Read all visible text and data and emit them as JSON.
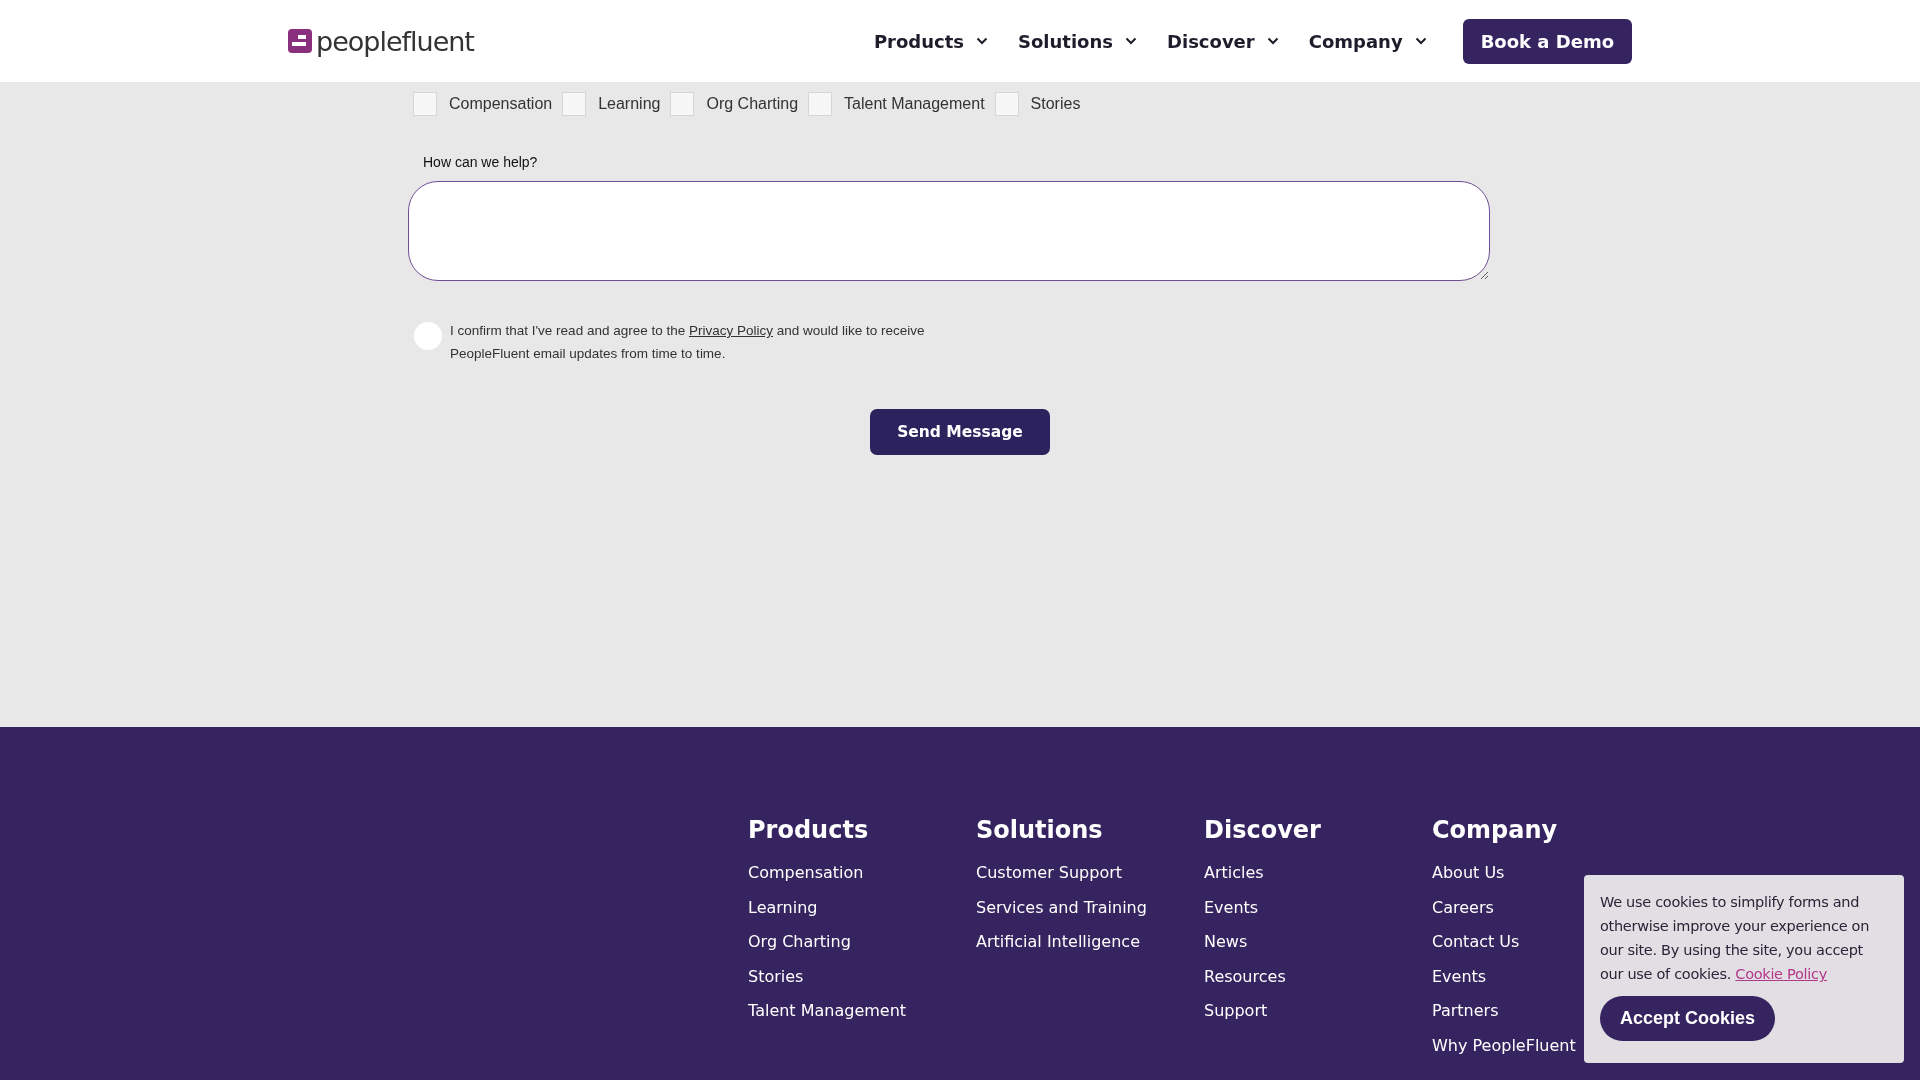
{
  "header": {
    "logo_text": "peoplefluent",
    "nav": [
      {
        "label": "Products"
      },
      {
        "label": "Solutions"
      },
      {
        "label": "Discover"
      },
      {
        "label": "Company"
      }
    ],
    "cta": "Book a Demo"
  },
  "form": {
    "interests": [
      {
        "label": "Compensation",
        "checked": false
      },
      {
        "label": "Learning",
        "checked": false
      },
      {
        "label": "Org Charting",
        "checked": false
      },
      {
        "label": "Talent Management",
        "checked": false
      },
      {
        "label": "Stories",
        "checked": false
      }
    ],
    "message_label": "How can we help?",
    "consent": {
      "checked": false,
      "text_before": "I confirm that I've read and agree to the",
      "link": "Privacy Policy",
      "text_after": "and would like to receive PeopleFluent email updates from time to time."
    },
    "submit": "Send Message"
  },
  "footer": {
    "columns": [
      {
        "heading": "Products",
        "links": [
          "Compensation",
          "Learning",
          "Org Charting",
          "Stories",
          "Talent Management"
        ]
      },
      {
        "heading": "Solutions",
        "links": [
          "Customer Support",
          "Services and Training",
          "Artificial Intelligence"
        ]
      },
      {
        "heading": "Discover",
        "links": [
          "Articles",
          "Events",
          "News",
          "Resources",
          "Support"
        ]
      },
      {
        "heading": "Company",
        "links": [
          "About Us",
          "Careers",
          "Contact Us",
          "Events",
          "Partners",
          "Why PeopleFluent"
        ]
      }
    ]
  },
  "cookie_banner": {
    "text": "We use cookies to simplify forms and otherwise improve your experience on our site. By using the site, you accept our use of cookies.",
    "link": "Cookie Policy",
    "button": "Accept Cookies"
  }
}
